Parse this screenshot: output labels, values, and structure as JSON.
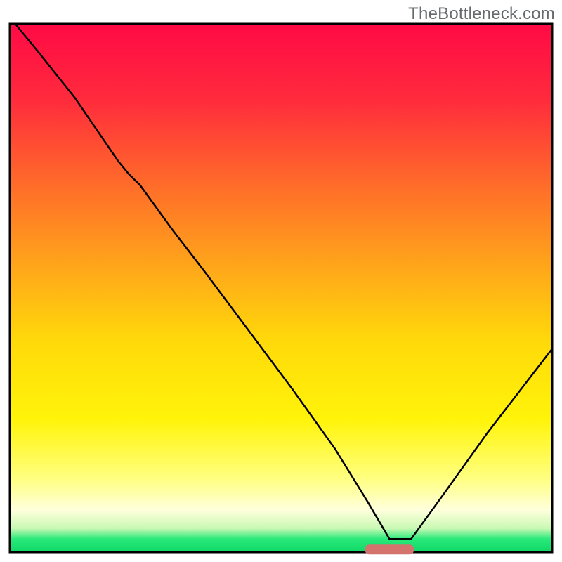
{
  "watermark": "TheBottleneck.com",
  "chart_data": {
    "type": "line",
    "title": "",
    "xlabel": "",
    "ylabel": "",
    "xlim": [
      0,
      100
    ],
    "ylim": [
      0,
      100
    ],
    "grid": false,
    "legend": null,
    "background": {
      "type": "multi-linear-gradient",
      "stops": [
        {
          "offset": 0.0,
          "color": "#ff0a45"
        },
        {
          "offset": 0.14,
          "color": "#ff2a3d"
        },
        {
          "offset": 0.3,
          "color": "#ff6a2a"
        },
        {
          "offset": 0.47,
          "color": "#ffaa19"
        },
        {
          "offset": 0.6,
          "color": "#ffd90a"
        },
        {
          "offset": 0.75,
          "color": "#fff40a"
        },
        {
          "offset": 0.86,
          "color": "#ffff80"
        },
        {
          "offset": 0.92,
          "color": "#ffffdc"
        },
        {
          "offset": 0.955,
          "color": "#c9f9b4"
        },
        {
          "offset": 0.975,
          "color": "#29e97a"
        },
        {
          "offset": 1.0,
          "color": "#0fd767"
        }
      ]
    },
    "marker": {
      "shape": "rounded-rect",
      "color": "#d4736d",
      "x_range": [
        65.5,
        74.5
      ],
      "y": 0.5
    },
    "series": [
      {
        "name": "curve",
        "stroke": "#000000",
        "stroke_width": 2.5,
        "x": [
          1.0,
          5.0,
          12.0,
          20.0,
          22.0,
          24.0,
          30.0,
          36.0,
          44.0,
          52.0,
          60.0,
          66.0,
          70.0,
          74.0,
          80.0,
          88.0,
          94.0,
          100.0
        ],
        "y": [
          100.0,
          95.0,
          86.0,
          74.0,
          71.5,
          69.5,
          61.0,
          53.0,
          42.0,
          31.0,
          19.5,
          9.5,
          2.5,
          2.5,
          11.0,
          22.5,
          30.5,
          38.5
        ]
      }
    ]
  }
}
